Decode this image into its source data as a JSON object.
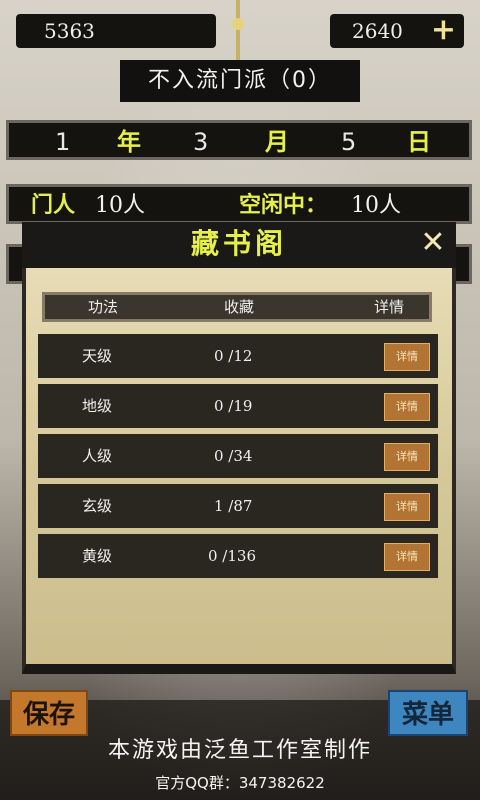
{
  "resources": {
    "left_value": "5363",
    "right_value": "2640",
    "add_symbol": "+"
  },
  "sect": {
    "title": "不入流门派（0）"
  },
  "date": {
    "year_value": "1",
    "year_unit": "年",
    "month_value": "3",
    "month_unit": "月",
    "day_value": "5",
    "day_unit": "日"
  },
  "people": {
    "members_label": "门人",
    "members_value": "10人",
    "idle_label": "空闲中：",
    "idle_value": "10人"
  },
  "dialog": {
    "title": "藏书阁",
    "close_symbol": "✕",
    "headers": [
      "功法",
      "收藏",
      "详情"
    ],
    "rows": [
      {
        "grade": "天级",
        "collected": "0 /12",
        "button": "详情"
      },
      {
        "grade": "地级",
        "collected": "0 /19",
        "button": "详情"
      },
      {
        "grade": "人级",
        "collected": "0 /34",
        "button": "详情"
      },
      {
        "grade": "玄级",
        "collected": "1 /87",
        "button": "详情"
      },
      {
        "grade": "黄级",
        "collected": "0 /136",
        "button": "详情"
      }
    ]
  },
  "bottom": {
    "save_label": "保存",
    "menu_label": "菜单",
    "credit": "本游戏由泛鱼工作室制作",
    "qq": "官方QQ群：347382622"
  },
  "colors": {
    "accent_yellow": "#e7f04a",
    "ink": "#15130f",
    "paper": "#d6c999",
    "detail_button": "#b27432",
    "save_button": "#c4782c",
    "menu_button": "#3e86c0"
  }
}
